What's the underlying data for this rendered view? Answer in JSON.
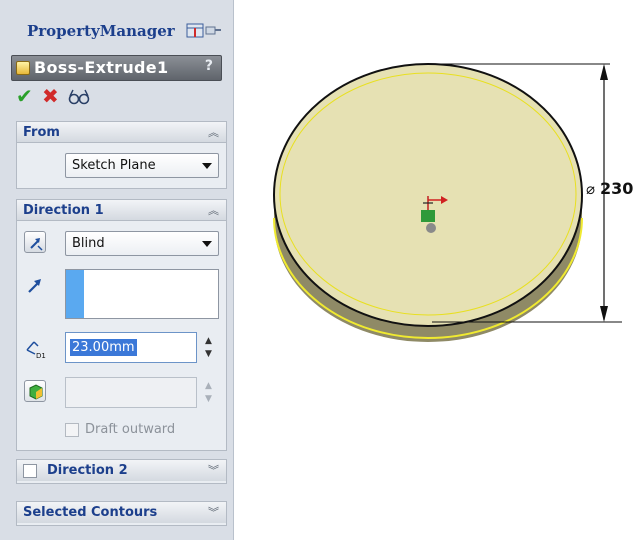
{
  "property_manager": {
    "title": "PropertyManager",
    "feature": {
      "name": "Boss-Extrude1",
      "help_label": "?"
    },
    "actions": {
      "ok_symbol": "✔",
      "cancel_symbol": "✖"
    },
    "from": {
      "header": "From",
      "start_condition": "Sketch Plane"
    },
    "direction1": {
      "header": "Direction 1",
      "end_condition": "Blind",
      "depth_value": "23.00mm",
      "draft_outward_label": "Draft outward",
      "draft_outward_checked": false
    },
    "direction2": {
      "header": "Direction 2",
      "checked": false
    },
    "selected_contours": {
      "header": "Selected Contours"
    }
  },
  "viewport": {
    "dimension_symbol": "⌀",
    "dimension_value": "230",
    "part_color": "#e6e1b3",
    "edge_highlight_color": "#f0ea30"
  },
  "icons": {
    "expanded_chevron": "︽",
    "collapsed_chevron": "︾"
  }
}
